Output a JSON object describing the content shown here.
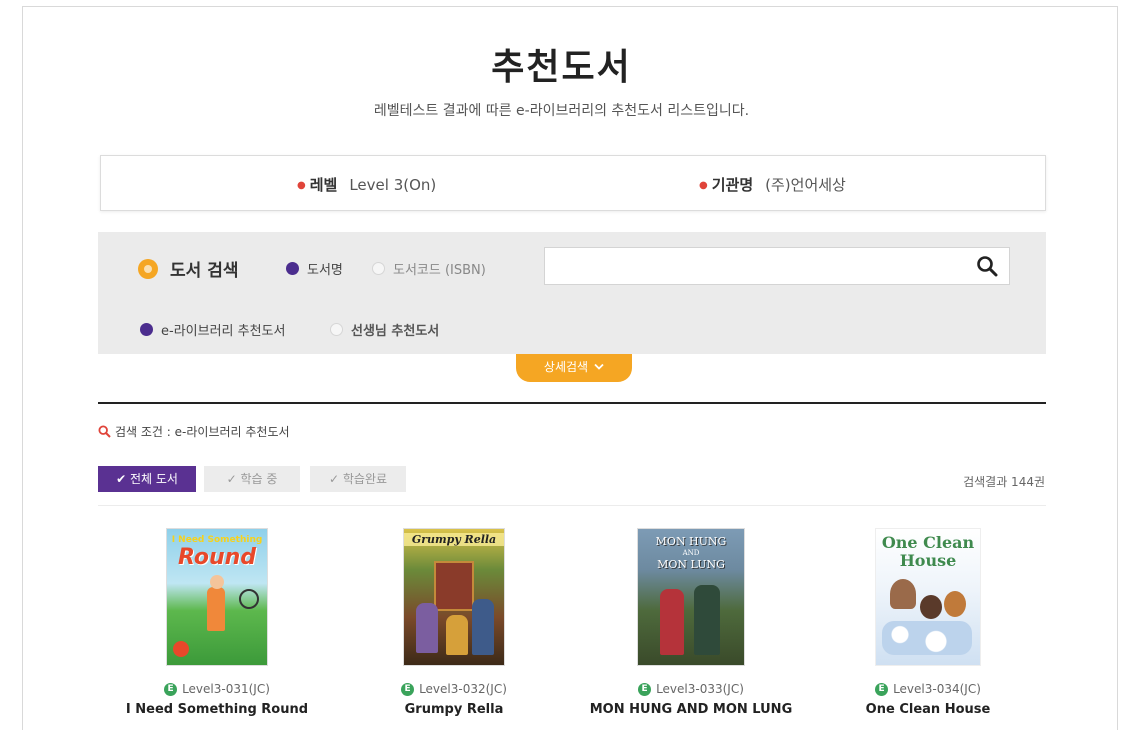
{
  "page": {
    "title": "추천도서",
    "subtitle": "레벨테스트 결과에 따른 e-라이브러리의 추천도서 리스트입니다."
  },
  "info": {
    "level_label": "레벨",
    "level_value": "Level 3(On)",
    "org_label": "기관명",
    "org_value": "(주)언어세상"
  },
  "search": {
    "heading": "도서 검색",
    "option_title": "도서명",
    "option_isbn": "도서코드 (ISBN)",
    "input_value": "",
    "input_placeholder": "",
    "source_elibrary": "e-라이브러리 추천도서",
    "source_teacher": "선생님 추천도서",
    "selected_option": "도서명",
    "selected_source": "e-라이브러리 추천도서"
  },
  "detail_search": {
    "label": "상세검색"
  },
  "condition": {
    "label": "검색 조건 : e-라이브러리 추천도서"
  },
  "filters": {
    "all": "전체 도서",
    "studying": "학습 중",
    "completed": "학습완료",
    "active": "전체 도서"
  },
  "result": {
    "count_text": "검색결과 144권"
  },
  "books": [
    {
      "code": "Level3-031(JC)",
      "title": "I Need Something Round",
      "cover_text": "I Need Something",
      "cover_text2": "Round",
      "badge": "E"
    },
    {
      "code": "Level3-032(JC)",
      "title": "Grumpy Rella",
      "cover_text": "Grumpy Rella",
      "badge": "E"
    },
    {
      "code": "Level3-033(JC)",
      "title": "MON HUNG AND MON LUNG",
      "cover_text": "MON HUNG",
      "cover_text2": "AND",
      "cover_text3": "MON LUNG",
      "badge": "E"
    },
    {
      "code": "Level3-034(JC)",
      "title": "One Clean House",
      "cover_text": "One Clean",
      "cover_text2": "House",
      "badge": "E"
    }
  ],
  "colors": {
    "accent_purple": "#5a3192",
    "accent_orange": "#f5a623",
    "bullet_red": "#e0443a",
    "ebook_green": "#3aa35b"
  }
}
